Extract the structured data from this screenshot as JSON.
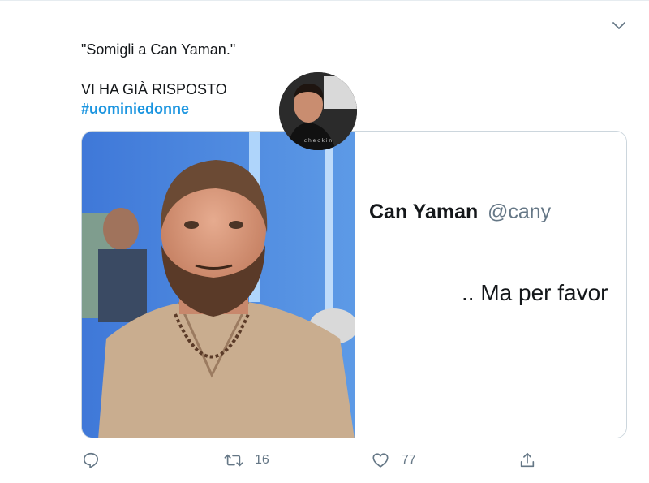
{
  "tweet": {
    "lines": [
      "\"Somigli a Can Yaman.\"",
      "VI HA GIÀ RISPOSTO"
    ],
    "hashtag": "#uominiedonne"
  },
  "embedded_tweet": {
    "name": "Can Yaman",
    "handle": "@cany",
    "reply": ".. Ma per favor",
    "avatar_caption": "c h e c k i n"
  },
  "actions": {
    "reply_count": "",
    "retweet_count": "16",
    "like_count": "77"
  },
  "colors": {
    "link": "#1b95e0",
    "text": "#14171a",
    "muted": "#657786",
    "border": "#ccd6dd"
  },
  "icons": [
    "chevron-down-icon",
    "reply-icon",
    "retweet-icon",
    "like-icon",
    "share-icon"
  ]
}
